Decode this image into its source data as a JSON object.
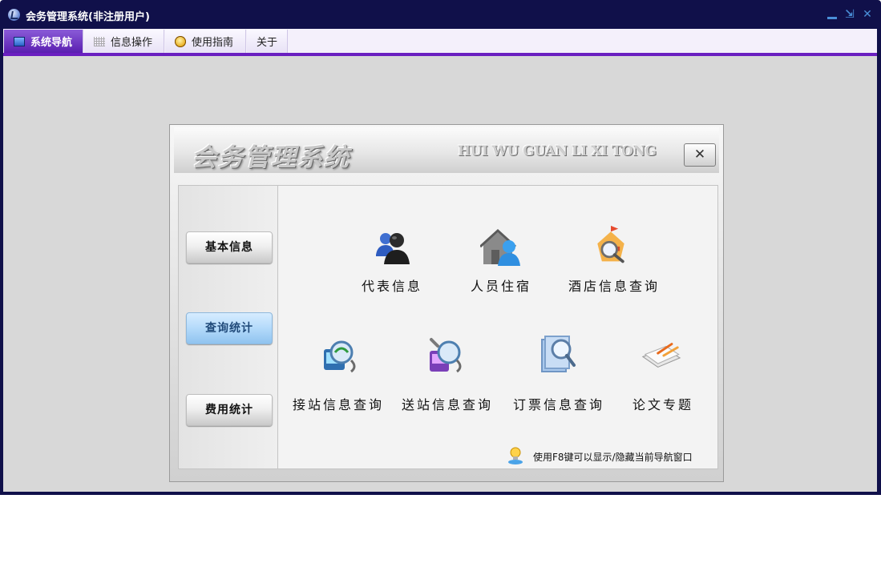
{
  "window": {
    "title": "会务管理系统(非注册用户)"
  },
  "menu": {
    "tabs": [
      {
        "label": "系统导航",
        "icon": "monitor-icon",
        "active": true
      },
      {
        "label": "信息操作",
        "icon": "grid-icon",
        "active": false
      },
      {
        "label": "使用指南",
        "icon": "guide-icon",
        "active": false
      },
      {
        "label": "关于",
        "icon": "",
        "active": false
      }
    ]
  },
  "nav_panel": {
    "logo_cn": "会务管理系统",
    "logo_en": "HUI WU GUAN LI XI TONG",
    "close_glyph": "✕",
    "sidebar": [
      {
        "label": "基本信息",
        "active": false
      },
      {
        "label": "查询统计",
        "active": true
      },
      {
        "label": "费用统计",
        "active": false
      }
    ],
    "items": [
      {
        "label": "代表信息",
        "icon": "people-icon"
      },
      {
        "label": "人员住宿",
        "icon": "house-person-icon"
      },
      {
        "label": "酒店信息查询",
        "icon": "hotel-search-icon"
      },
      {
        "label": "接站信息查询",
        "icon": "pickup-search-icon"
      },
      {
        "label": "送站信息查询",
        "icon": "dropoff-search-icon"
      },
      {
        "label": "订票信息查询",
        "icon": "ticket-search-icon"
      },
      {
        "label": "论文专题",
        "icon": "paper-icon"
      }
    ],
    "hint": "使用F8键可以显示/隐藏当前导航窗口"
  },
  "colors": {
    "titlebar": "#10104a",
    "accent_line": "#6a1fc0",
    "client_bg": "#d8d8d8"
  }
}
